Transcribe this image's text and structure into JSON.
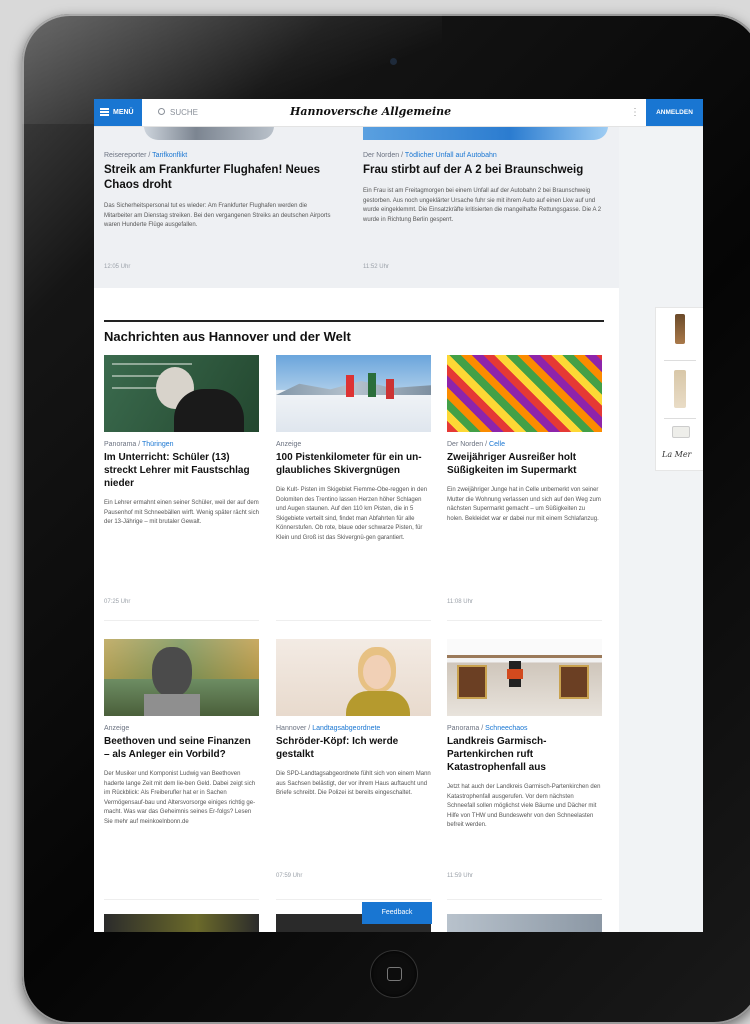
{
  "header": {
    "menu_label": "MENÜ",
    "search_placeholder": "SUCHE",
    "logo": "Hannoversche Allgemeine",
    "login_label": "ANMELDEN",
    "more_label": "⋮"
  },
  "top_articles": [
    {
      "kicker": "Reisereporter",
      "kicker_sub": "Tarifkonflikt",
      "title": "Streik am Frankfurter Flughafen! Neues Chaos droht",
      "body": "Das Sicherheitspersonal tut es wieder: Am Frankfurter Flughafen werden die Mitarbeiter am Dienstag streiken. Bei den vergangenen Streiks an deutschen Airports waren Hunderte Flüge ausgefallen.",
      "time": "12:05 Uhr"
    },
    {
      "kicker": "Der Norden",
      "kicker_sub": "Tödlicher Unfall auf Autobahn",
      "title": "Frau stirbt auf der A 2 bei Braunschweig",
      "body": "Ein Frau ist am Freitagmorgen bei einem Unfall auf der Autobahn 2 bei Braunschweig gestorben. Aus noch ungeklärter Ursache fuhr sie mit ihrem Auto auf einen Lkw auf und wurde eingeklemmt. Die Einsatzkräfte kritisierten die mangelhafte Rettungsgasse. Die A 2 wurde in Richtung Berlin gesperrt.",
      "time": "11:52 Uhr"
    }
  ],
  "section_title": "Nachrichten aus Hannover und der Welt",
  "cards": [
    {
      "kicker": "Panorama",
      "kicker_sub": "Thüringen",
      "title": "Im Unterricht: Schüler (13) streckt Lehrer mit Faustschlag nieder",
      "body": "Ein Lehrer ermahnt einen seiner Schüler, weil der auf dem Pausenhof mit Schneebällen wirft. Wenig später rächt sich der 13-Jährige – mit brutaler Gewalt.",
      "time": "07:25 Uhr"
    },
    {
      "kicker": "Anzeige",
      "kicker_sub": "",
      "title": "100 Pistenkilometer für ein un-glaubliches Skivergnügen",
      "body": "Die Kult- Pisten im Skigebiet Fiemme-Obe-reggen in den Dolomiten des Trentino lassen Herzen höher Schlagen und Augen staunen. Auf den 110 km Pisten, die in 5 Skigebiete verteilt sind, findet man Abfahrten für alle Könnerstufen. Ob rote, blaue oder schwarze Pisten, für Klein und Groß ist das Skivergnü-gen garantiert.",
      "time": ""
    },
    {
      "kicker": "Der Norden",
      "kicker_sub": "Celle",
      "title": "Zweijähriger Ausreißer holt Süßigkeiten im Supermarkt",
      "body": "Ein zweijähriger Junge hat in Celle unbemerkt von seiner Mutter die Wohnung verlassen und sich auf den Weg zum nächsten Supermarkt gemacht – um Süßigkeiten zu holen. Bekleidet war er dabei nur mit einem Schlafanzug.",
      "time": "11:08 Uhr"
    },
    {
      "kicker": "Anzeige",
      "kicker_sub": "",
      "title": "Beethoven und seine Finanzen – als Anleger ein Vorbild?",
      "body": "Der Musiker und Komponist Ludwig van Beethoven haderte lange Zeit mit dem lie-ben Geld. Dabei zeigt sich im Rückblick: Als Freiberufler hat er in Sachen Vermögensauf-bau und Altersvorsorge einiges richtig ge-macht. Was war das Geheimnis seines Er-folgs? Lesen Sie mehr auf meinkoelnbonn.de",
      "time": ""
    },
    {
      "kicker": "Hannover",
      "kicker_sub": "Landtagsabgeordnete",
      "title": "Schröder-Köpf: Ich werde gestalkt",
      "body": "Die SPD-Landtagsabgeordnete fühlt sich von einem Mann aus Sachsen belästigt, der vor ihrem Haus auftaucht und Briefe schreibt. Die Polizei ist bereits eingeschaltet.",
      "time": "07:59 Uhr"
    },
    {
      "kicker": "Panorama",
      "kicker_sub": "Schneechaos",
      "title": "Landkreis Garmisch-Partenkirchen ruft Katastrophenfall aus",
      "body": "Jetzt hat auch der Landkreis Garmisch-Partenkirchen den Katastrophenfall ausgerufen. Vor dem nächsten Schneefall sollen möglichst viele Bäume und Dächer mit Hilfe von THW und Bundeswehr von den Schneelasten befreit werden.",
      "time": "11:59 Uhr"
    }
  ],
  "feedback_label": "Feedback",
  "ad_text": "La Mer"
}
